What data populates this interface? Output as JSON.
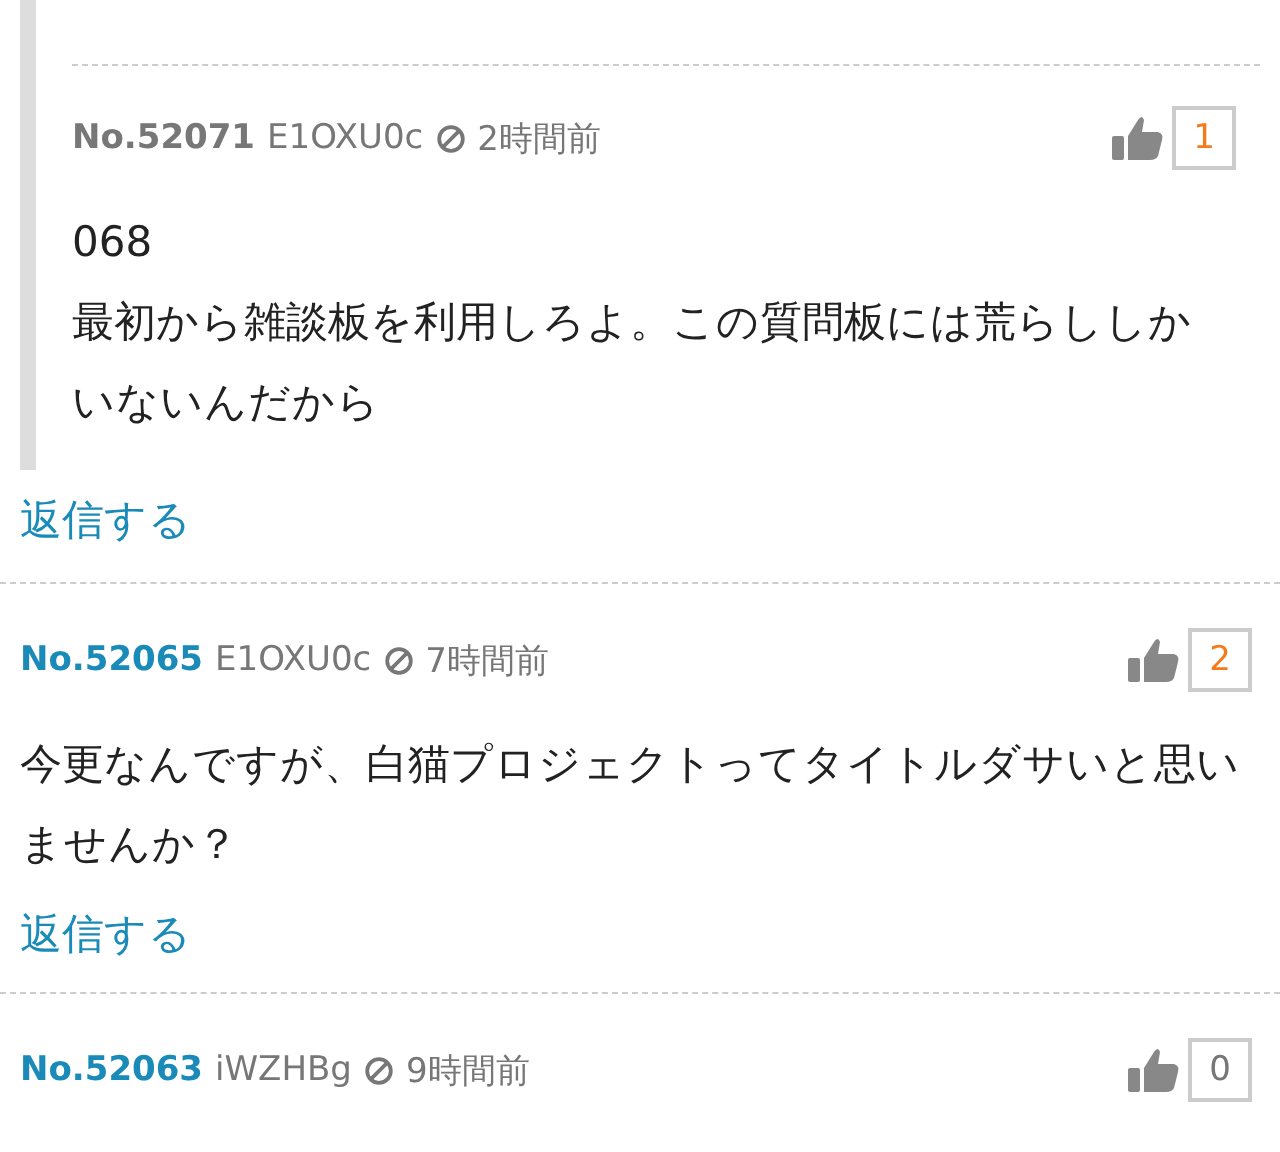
{
  "posts": [
    {
      "kind": "reply",
      "number": "No.52071",
      "user_id": "E1OXU0c",
      "time": "2時間前",
      "likes": "1",
      "highlighted": true,
      "lines": [
        "068",
        "最初から雑談板を利用しろよ。この質問板には荒らししかいないんだから"
      ]
    },
    {
      "kind": "post",
      "number": "No.52065",
      "user_id": "E1OXU0c",
      "time": "7時間前",
      "likes": "2",
      "highlighted": true,
      "lines": [
        "今更なんですが、白猫プロジェクトってタイトルダサいと思いませんか？"
      ],
      "reply_link": "返信する"
    },
    {
      "kind": "post",
      "number": "No.52063",
      "user_id": "iWZHBg",
      "time": "9時間前",
      "likes": "0",
      "highlighted": false
    }
  ],
  "thread_reply_link": "返信する"
}
